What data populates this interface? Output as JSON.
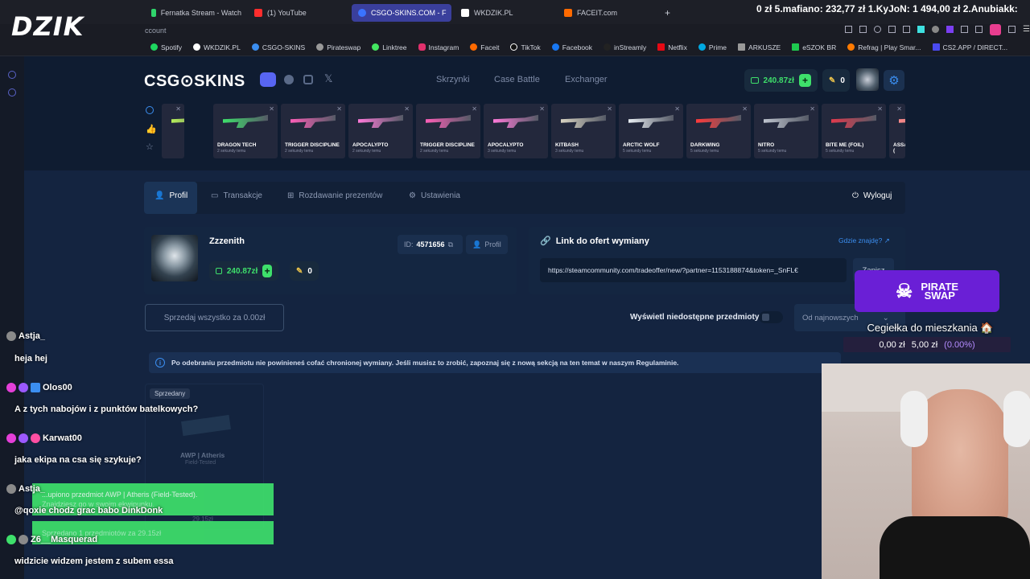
{
  "browser": {
    "tabs": [
      {
        "label": "Fernatka Stream - Watch",
        "color": "#2fd46b"
      },
      {
        "label": "(1) YouTube",
        "color": "#ff2d2d"
      },
      {
        "label": "CSGO-SKINS.COM - F",
        "color": "#3a73ff"
      },
      {
        "label": "WKDZIK.PL",
        "color": "#ffffff"
      },
      {
        "label": "FACEIT.com",
        "color": "#ff6a00"
      }
    ],
    "url_fragment": "ccount",
    "bookmarks": [
      "Spotify",
      "WKDZIK.PL",
      "CSGO-SKINS",
      "Pirateswap",
      "Linktree",
      "Instagram",
      "Faceit",
      "TikTok",
      "Facebook",
      "inStreamly",
      "Netflix",
      "Prime",
      "ARKUSZE",
      "eSZOK BR",
      "Refrag | Play Smar...",
      "CS2.APP / DIRECT..."
    ]
  },
  "stream": {
    "brand": "DZIK",
    "ticker": "0 zł   5.mafiano: 232,77 zł   1.KyJoN: 1 494,00 zł   2.Anubiakk:"
  },
  "site": {
    "logo": "CSG⊙SKINS",
    "nav": [
      "Skrzynki",
      "Case Battle",
      "Exchanger"
    ],
    "balance": "240.87zł",
    "keys": "0",
    "accent": "#3b8ef0",
    "live_drops": [
      {
        "name": "",
        "sub": "",
        "color": "#b7f05a"
      },
      {
        "name": "DRAGON TECH",
        "sub": "2 sekundy temu",
        "color": "#3ee06b"
      },
      {
        "name": "TRIGGER DISCIPLINE",
        "sub": "2 sekundy temu",
        "color": "#ff5fb8"
      },
      {
        "name": "APOCALYPTO",
        "sub": "2 sekundy temu",
        "color": "#ff7ad9"
      },
      {
        "name": "TRIGGER DISCIPLINE",
        "sub": "2 sekundy temu",
        "color": "#ff5fb8"
      },
      {
        "name": "APOCALYPTO",
        "sub": "3 sekundy temu",
        "color": "#ff7ad9"
      },
      {
        "name": "KITBASH",
        "sub": "3 sekundy temu",
        "color": "#d9d4c2"
      },
      {
        "name": "ARCTIC WOLF",
        "sub": "5 sekundy temu",
        "color": "#e9eef3"
      },
      {
        "name": "DARKWING",
        "sub": "5 sekundy temu",
        "color": "#ff3b3b"
      },
      {
        "name": "NITRO",
        "sub": "5 sekundy temu",
        "color": "#bfc5cf"
      },
      {
        "name": "BITE ME (FOIL)",
        "sub": "5 sekundy temu",
        "color": "#e23a4d"
      },
      {
        "name": "ASSASSIN (",
        "sub": "",
        "color": "#ff8a8a"
      }
    ],
    "profile_tabs": [
      "Profil",
      "Transakcje",
      "Rozdawanie prezentów",
      "Ustawienia"
    ],
    "logout": "Wyloguj",
    "user": {
      "name": "Zzzenith",
      "id_label": "ID:",
      "id": "4571656",
      "profile_btn": "Profil",
      "balance": "240.87zł",
      "keys": "0"
    },
    "trade": {
      "title": "Link do ofert wymiany",
      "help": "Gdzie znajdę?",
      "url": "https://steamcommunity.com/tradeoffer/new/?partner=1153188874&token=_SnFL€",
      "save": "Zapisz"
    },
    "sell_all": "Sprzedaj wszystko za 0.00zł",
    "show_unavailable": "Wyświetl niedostępne przedmioty",
    "sort": "Od najnowszych",
    "notice": "Po odebraniu przedmiotu nie powinieneś cofać chronionej wymiany. Jeśli musisz to zrobić, zapoznaj się z nową sekcją na ten temat w naszym Regulaminie.",
    "item": {
      "badge": "Sprzedany",
      "name": "AWP | Atheris",
      "wear": "Field-Tested",
      "price": "29.15zł"
    }
  },
  "chat": [
    {
      "user": "Astja_",
      "msg": "heja hej",
      "color": "#ffffff"
    },
    {
      "user": "Olos00",
      "msg": "A z tych nabojów i z punktów batelkowych?",
      "color": "#ffffff"
    },
    {
      "user": "Karwat00",
      "msg": "jaka ekipa na csa się szykuje?",
      "color": "#ffffff"
    },
    {
      "user": "Astja_",
      "msg": "@qoxie chodz grac babo DinkDonk",
      "color": "#ffffff"
    },
    {
      "user": "Z6__Masquerad",
      "msg": "widzicie widzem jestem z subem essa",
      "color": "#ffffff"
    }
  ],
  "toasts": [
    {
      "line1": "...upiono przedmiot AWP | Atheris (Field-Tested).",
      "line2": "Znajdziesz go w swoim ekwipunku."
    },
    {
      "line1": "Sprzedano 1 przedmiotów za 29.15zł",
      "line2": ""
    }
  ],
  "pirate": {
    "line1": "PIRATE",
    "line2": "SWAP"
  },
  "goal": {
    "title": "Cegiełka do mieszkania 🏠",
    "current": "0,00 zł",
    "target": "5,00 zł",
    "percent": "(0.00%)",
    "percent_color": "#b48cff"
  }
}
